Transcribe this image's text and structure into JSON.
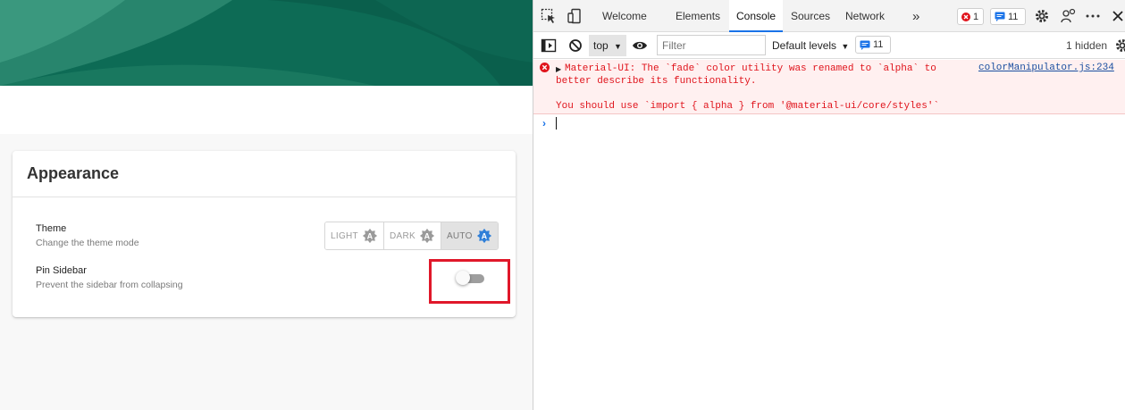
{
  "app": {
    "card_title": "Appearance",
    "theme": {
      "label": "Theme",
      "description": "Change the theme mode",
      "options": [
        "LIGHT",
        "DARK",
        "AUTO"
      ],
      "selected": "AUTO"
    },
    "pin_sidebar": {
      "label": "Pin Sidebar",
      "description": "Prevent the sidebar from collapsing",
      "enabled": false
    },
    "colors": {
      "banner": "#0b6a55",
      "highlight": "#e0182a",
      "auto_badge": "#2f7fd8"
    }
  },
  "devtools": {
    "tabs": [
      "Welcome",
      "Elements",
      "Console",
      "Sources",
      "Network"
    ],
    "active_tab": "Console",
    "more_tabs_glyph": "»",
    "error_count": "1",
    "message_count": "11",
    "context": "top",
    "filter_placeholder": "Filter",
    "levels": "Default levels",
    "issues_count": "11",
    "hidden": "1 hidden",
    "console": {
      "error_line1": "Material-UI: The `fade` color utility was renamed to `alpha` to",
      "error_line2": "better describe its functionality.",
      "error_line3": "You should use `import { alpha } from '@material-ui/core/styles'`",
      "source": "colorManipulator.js:234"
    }
  }
}
